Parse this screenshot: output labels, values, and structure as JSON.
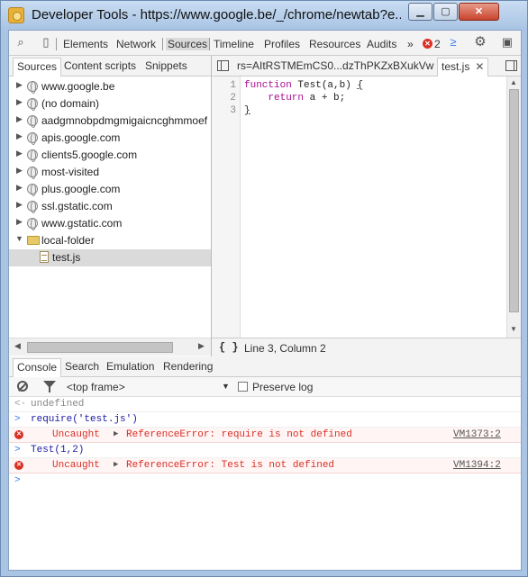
{
  "window": {
    "title": "Developer Tools - https://www.google.be/_/chrome/newtab?e...",
    "min_label": "▁",
    "max_label": "▢",
    "close_label": "✕"
  },
  "toolbar": {
    "tabs": [
      "Elements",
      "Network",
      "Sources",
      "Timeline",
      "Profiles",
      "Resources",
      "Audits"
    ],
    "active_tab": "Sources",
    "more_label": "»",
    "error_count": "2"
  },
  "navigator": {
    "tabs": [
      "Sources",
      "Content scripts",
      "Snippets"
    ],
    "items": [
      {
        "label": "www.google.be",
        "kind": "domain"
      },
      {
        "label": "(no domain)",
        "kind": "domain"
      },
      {
        "label": "aadgmnobpdmgmigaicncghmmoef",
        "kind": "domain"
      },
      {
        "label": "apis.google.com",
        "kind": "domain"
      },
      {
        "label": "clients5.google.com",
        "kind": "domain"
      },
      {
        "label": "most-visited",
        "kind": "domain"
      },
      {
        "label": "plus.google.com",
        "kind": "domain"
      },
      {
        "label": "ssl.gstatic.com",
        "kind": "domain"
      },
      {
        "label": "www.gstatic.com",
        "kind": "domain"
      },
      {
        "label": "local-folder",
        "kind": "folder"
      },
      {
        "label": "test.js",
        "kind": "file"
      }
    ]
  },
  "editor": {
    "tabs": [
      "rs=AItRSTMEmCS0...dzThPKZxBXukVw",
      "test.js"
    ],
    "active_tab": "test.js",
    "line_numbers": [
      "1",
      "2",
      "3"
    ],
    "code": {
      "line1_keyword": "function",
      "line1_rest": " Test(a,b) ",
      "line1_brace": "{",
      "line2_keyword": "return",
      "line2_rest": " a + b;",
      "line3_brace": "}"
    },
    "pretty_print": "{ }",
    "cursor_position": "Line 3, Column 2"
  },
  "drawer": {
    "tabs": [
      "Console",
      "Search",
      "Emulation",
      "Rendering"
    ],
    "active_tab": "Console",
    "frame": "<top frame>",
    "preserve_log_label": "Preserve log",
    "preserve_log_checked": false
  },
  "console": {
    "lines": [
      {
        "type": "output",
        "prompt": "<·",
        "text": "undefined"
      },
      {
        "type": "input",
        "prompt": ">",
        "text": "require('test.js')"
      },
      {
        "type": "error",
        "prefix": "Uncaught",
        "message": "ReferenceError: require is not defined",
        "link": "VM1373:2"
      },
      {
        "type": "input",
        "prompt": ">",
        "text": "Test(1,2)"
      },
      {
        "type": "error",
        "prefix": "Uncaught",
        "message": "ReferenceError: Test is not defined",
        "link": "VM1394:2"
      },
      {
        "type": "prompt",
        "prompt": ">",
        "text": ""
      }
    ]
  },
  "colors": {
    "error": "#d93025",
    "keyword": "#aa0d91",
    "prompt": "#367cf1"
  }
}
